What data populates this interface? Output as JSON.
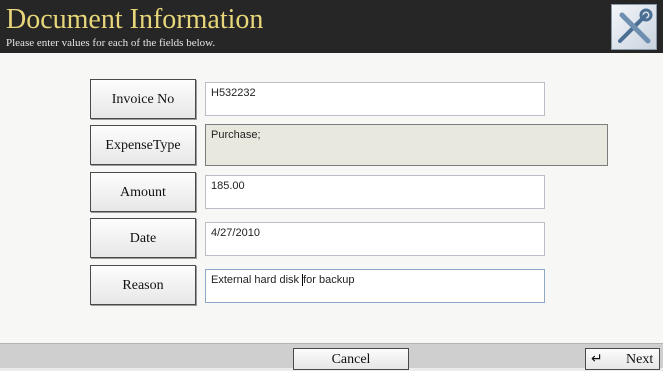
{
  "header": {
    "title": "Document Information",
    "subtitle": "Please enter values for each of the fields below.",
    "icon": "tools-icon"
  },
  "fields": [
    {
      "label": "Invoice No",
      "value": "H532232"
    },
    {
      "label": "ExpenseType",
      "value": "Purchase;"
    },
    {
      "label": "Amount",
      "value": "185.00"
    },
    {
      "label": "Date",
      "value": "4/27/2010"
    },
    {
      "label": "Reason",
      "value_before_caret": "External hard disk ",
      "value_after_caret": "for backup"
    }
  ],
  "footer": {
    "cancel_label": "Cancel",
    "next_label": "Next",
    "next_icon": "enter-return-icon"
  },
  "colors": {
    "header_bg": "#262626",
    "title_color": "#e8d67a",
    "readonly_bg": "#e9e8df"
  }
}
